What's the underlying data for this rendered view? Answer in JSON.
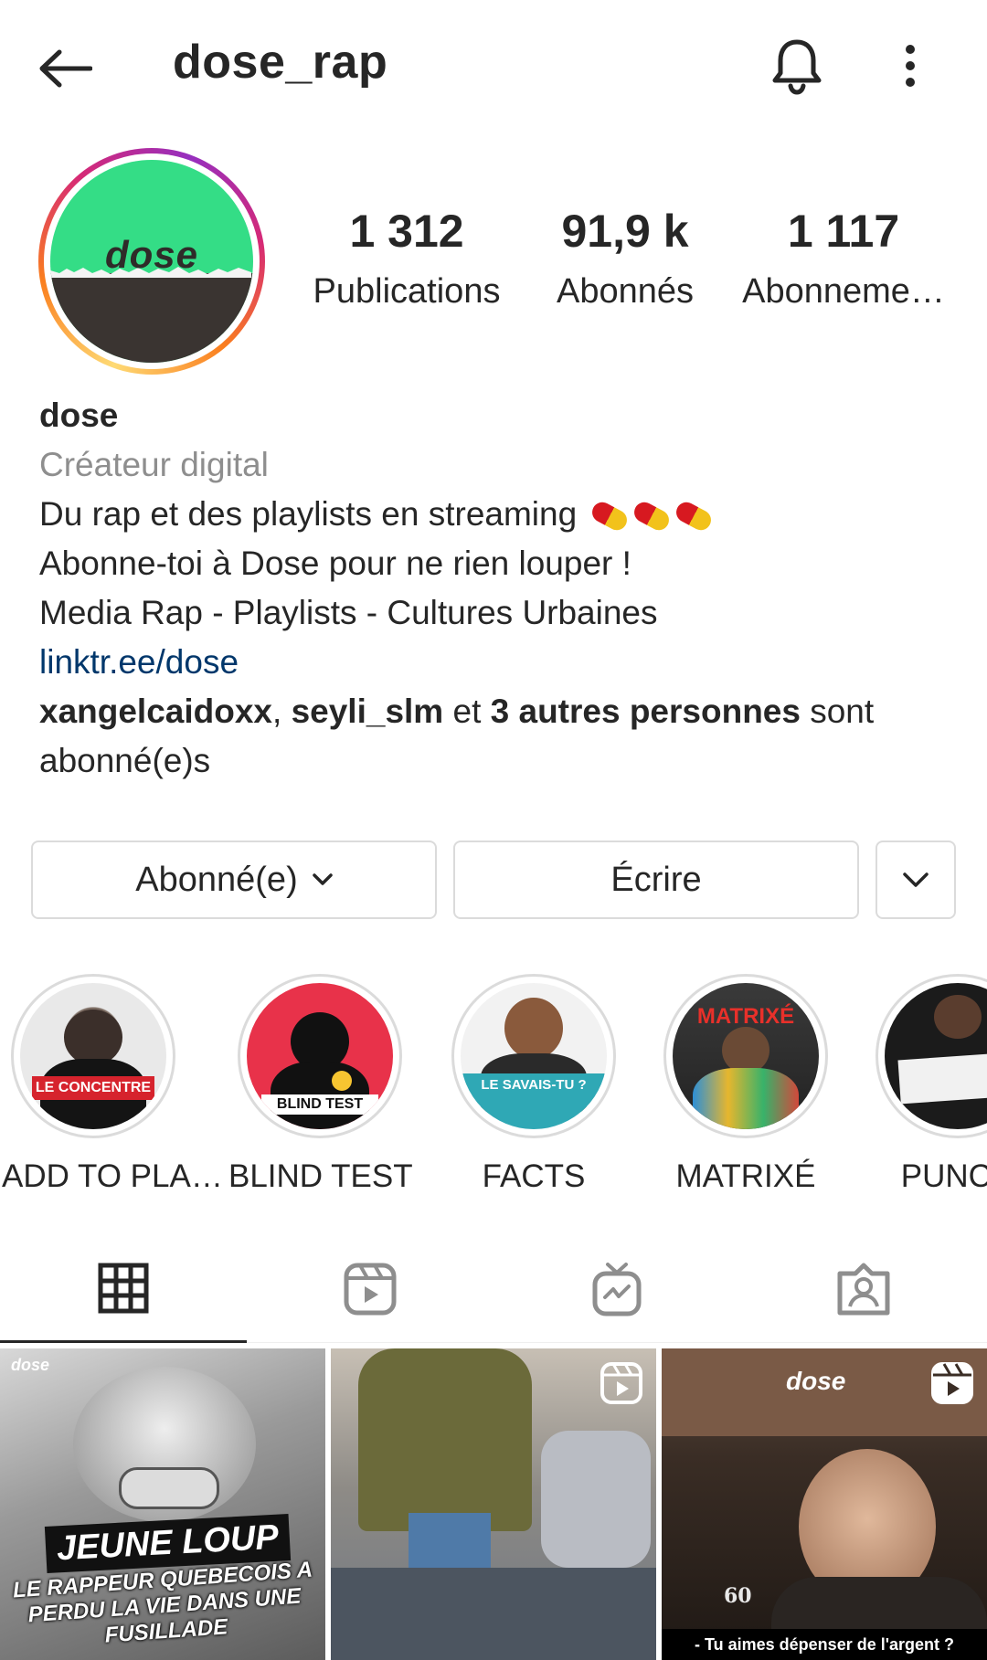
{
  "header": {
    "username": "dose_rap",
    "back_icon": "arrow-left-icon",
    "bell_icon": "bell-icon",
    "more_icon": "more-vertical-icon"
  },
  "profile": {
    "avatar_text": "dose",
    "stats": {
      "posts_count": "1 312",
      "posts_label": "Publications",
      "followers_count": "91,9 k",
      "followers_label": "Abonnés",
      "following_count": "1 117",
      "following_label": "Abonneme…"
    }
  },
  "bio": {
    "name": "dose",
    "category": "Créateur digital",
    "line1": "Du rap et des playlists en streaming",
    "line2": "Abonne-toi à Dose pour ne rien louper !",
    "line3": "Media Rap - Playlists - Cultures Urbaines",
    "link": "linktr.ee/dose",
    "mutual_user1": "xangelcaidoxx",
    "mutual_sep": ", ",
    "mutual_user2": "seyli_slm",
    "mutual_and": " et ",
    "mutual_others": "3 autres personnes",
    "mutual_tail": " sont",
    "mutual_line2": "abonné(e)s"
  },
  "actions": {
    "follow_label": "Abonné(e)",
    "message_label": "Écrire",
    "suggest_icon": "chevron-down-icon"
  },
  "highlights": [
    {
      "label": "ADD TO PLA…",
      "overlay": "LE CONCENTRE",
      "color": "#2b2b2b"
    },
    {
      "label": "BLIND TEST",
      "overlay": "BLIND TEST",
      "color": "#e8324a"
    },
    {
      "label": "FACTS",
      "overlay": "LE SAVAIS-TU ?",
      "color": "#2fa8b5"
    },
    {
      "label": "MATRIXÉ",
      "overlay": "MATRIXÉ",
      "color": "#d23a2a"
    },
    {
      "label": "PUNCH",
      "overlay": "",
      "color": "#1b1b1b"
    }
  ],
  "tabs": [
    {
      "name": "grid",
      "icon": "grid-icon"
    },
    {
      "name": "reels",
      "icon": "reels-icon"
    },
    {
      "name": "igtv",
      "icon": "igtv-icon"
    },
    {
      "name": "tagged",
      "icon": "tagged-user-icon"
    }
  ],
  "posts": [
    {
      "brand": "dose",
      "headline": "JEUNE LOUP",
      "subtitle": "LE RAPPEUR QUEBECOIS A PERDU LA VIE DANS UNE FUSILLADE"
    },
    {
      "badge_icon": "reels-icon"
    },
    {
      "brand": "dose",
      "badge_icon": "reels-icon",
      "logo_text": "60",
      "caption": "- Tu aimes dépenser de l'argent ?"
    }
  ],
  "colors": {
    "text": "#262626",
    "muted": "#8e8e8e",
    "link": "#00376b",
    "border": "#dbdbdb",
    "brand_green": "#34dd86"
  }
}
